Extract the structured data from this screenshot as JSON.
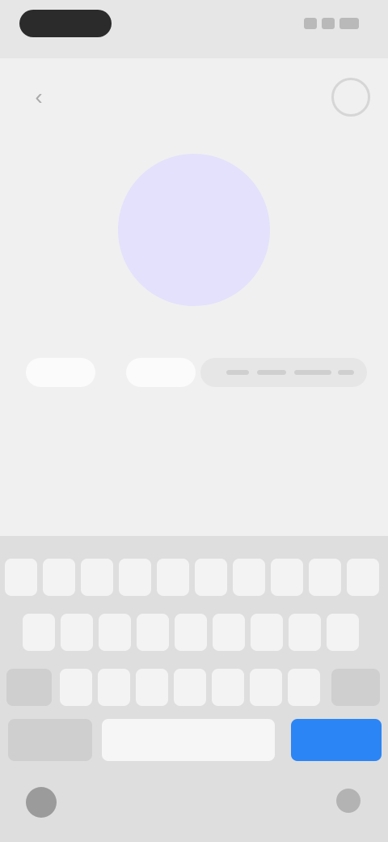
{
  "status_bar": {
    "time": "",
    "icons": [
      "signal-icon",
      "wifi-icon",
      "battery-icon"
    ]
  },
  "header": {
    "back_icon": "chevron-left-icon",
    "action_icon": "circle-outline-icon"
  },
  "avatar": {
    "color": "#e3e1fc"
  },
  "fields": {
    "first": "",
    "separator": "",
    "second": "",
    "third": ""
  },
  "keyboard": {
    "row1": [
      "",
      "",
      "",
      "",
      "",
      "",
      "",
      "",
      "",
      ""
    ],
    "row2": [
      "",
      "",
      "",
      "",
      "",
      "",
      "",
      "",
      ""
    ],
    "row3": [
      "",
      "",
      "",
      "",
      "",
      "",
      "",
      "",
      ""
    ],
    "row4": {
      "left_label": "",
      "space_label": "",
      "go_label": ""
    },
    "bottom_left_icon": "globe-icon",
    "bottom_right_icon": "microphone-icon"
  },
  "colors": {
    "background": "#eeeeee",
    "accent": "#2c85f5",
    "avatar": "#e3e1fc"
  }
}
